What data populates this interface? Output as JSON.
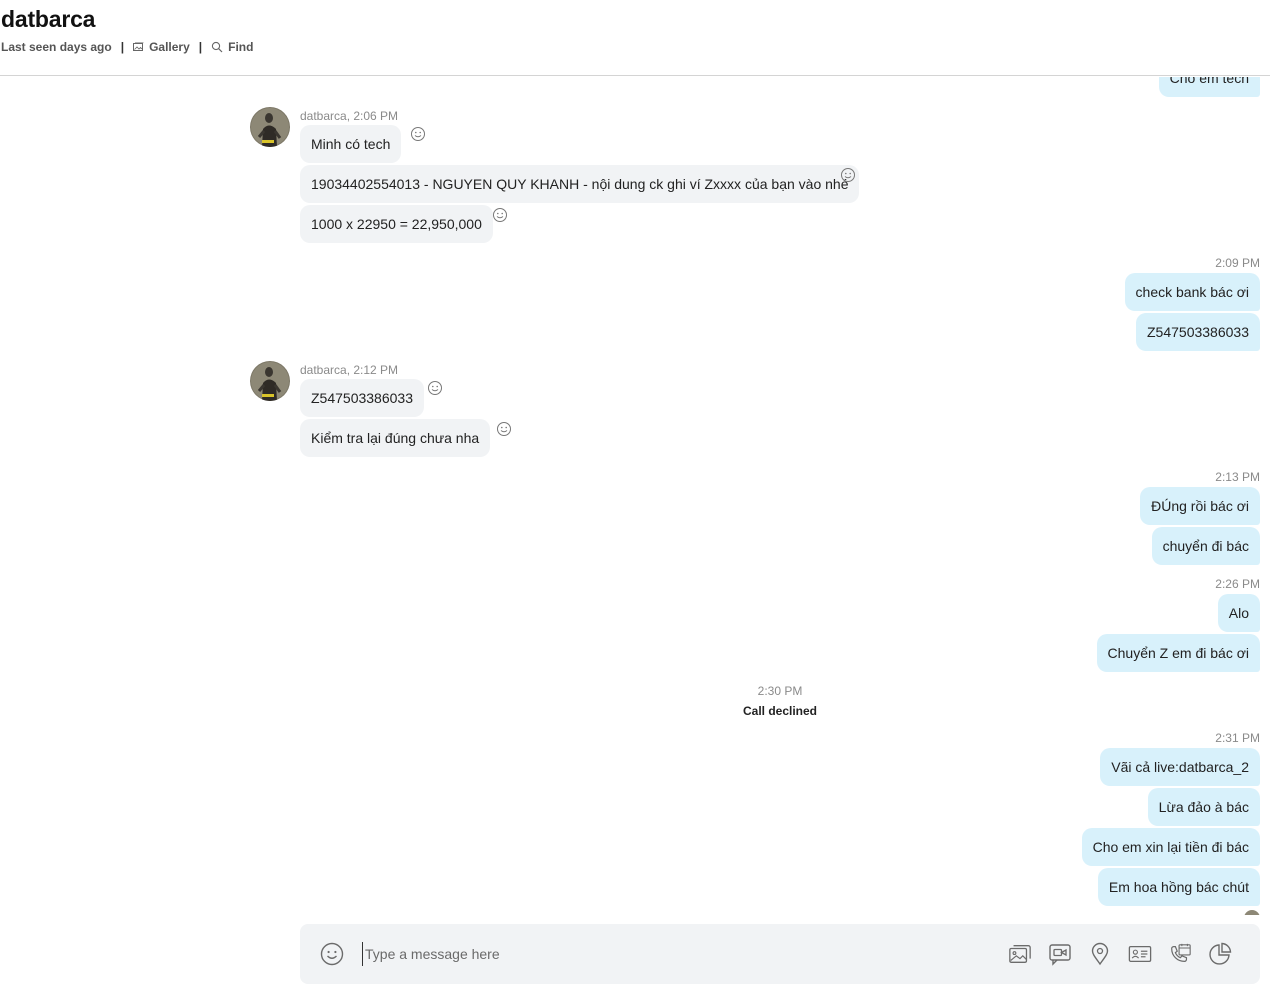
{
  "header": {
    "title": "datbarca",
    "last_seen": "Last seen days ago",
    "gallery_label": "Gallery",
    "find_label": "Find"
  },
  "messages": {
    "top_partial_out": "Cho em tech",
    "group1": {
      "sender_time": "datbarca, 2:06 PM",
      "m1": "Minh có tech",
      "m2": "19034402554013 - NGUYEN QUY KHANH - nội dung ck ghi ví Zxxxx của bạn vào nhé",
      "m3": "1000 x 22950 = 22,950,000"
    },
    "out1": {
      "time": "2:09 PM",
      "m1": "check bank bác ơi",
      "m2": "Z547503386033"
    },
    "group2": {
      "sender_time": "datbarca, 2:12 PM",
      "m1": "Z547503386033",
      "m2": "Kiểm tra lại đúng chưa nha"
    },
    "out2": {
      "time": "2:13 PM",
      "m1": "ĐÚng rồi bác ơi",
      "m2": "chuyển đi bác"
    },
    "out3": {
      "time": "2:26 PM",
      "m1": "Alo",
      "m2": "Chuyển Z em đi bác ơi"
    },
    "call": {
      "time": "2:30 PM",
      "text": "Call declined"
    },
    "out4": {
      "time": "2:31 PM",
      "m1": "Vãi cả live:datbarca_2",
      "m2": "Lừa đảo à bác",
      "m3": "Cho em xin lại tiền đi bác",
      "m4": "Em hoa hồng bác chút"
    }
  },
  "composer": {
    "placeholder": "Type a message here",
    "value": ""
  },
  "colors": {
    "outgoing_bubble": "#d8f1fb",
    "incoming_bubble": "#f1f3f5",
    "icon": "#6b6b6b"
  },
  "icons": [
    "gallery-icon",
    "search-icon",
    "emoji-icon",
    "smiley-react-icon",
    "image-icon",
    "video-message-icon",
    "location-icon",
    "contact-card-icon",
    "schedule-call-icon",
    "poll-icon"
  ]
}
